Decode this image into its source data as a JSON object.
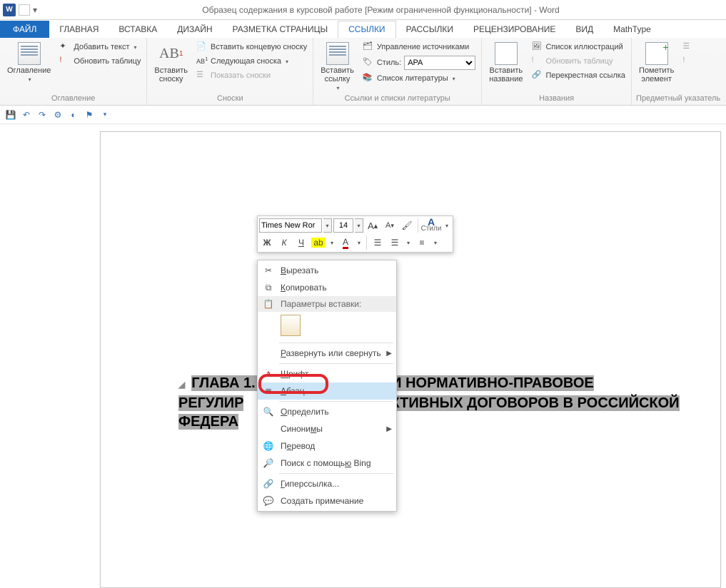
{
  "titlebar": {
    "title": "Образец содержания в курсовой работе [Режим ограниченной функциональности] - Word"
  },
  "tabs": {
    "file": "ФАЙЛ",
    "home": "ГЛАВНАЯ",
    "insert": "ВСТАВКА",
    "design": "ДИЗАЙН",
    "layout": "РАЗМЕТКА СТРАНИЦЫ",
    "references": "ССЫЛКИ",
    "mailings": "РАССЫЛКИ",
    "review": "РЕЦЕНЗИРОВАНИЕ",
    "view": "ВИД",
    "mathtype": "MathType"
  },
  "ribbon": {
    "toc_group": {
      "label": "Оглавление",
      "toc_btn": "Оглавление",
      "add_text": "Добавить текст",
      "update": "Обновить таблицу"
    },
    "footnotes_group": {
      "label": "Сноски",
      "insert_footnote": "Вставить\nсноску",
      "insert_endnote": "Вставить концевую сноску",
      "next_footnote": "Следующая сноска",
      "show_notes": "Показать сноски"
    },
    "citations_group": {
      "label": "Ссылки и списки литературы",
      "insert_citation": "Вставить\nссылку",
      "manage_sources": "Управление источниками",
      "style_label": "Стиль:",
      "style_value": "APA",
      "bibliography": "Список литературы"
    },
    "captions_group": {
      "label": "Названия",
      "insert_caption": "Вставить\nназвание",
      "table_of_figures": "Список иллюстраций",
      "update_table": "Обновить таблицу",
      "cross_reference": "Перекрестная ссылка"
    },
    "index_group": {
      "label": "Предметный указатель",
      "mark_entry": "Пометить\nэлемент"
    }
  },
  "mini_toolbar": {
    "font_name": "Times New Ror",
    "font_size": "14",
    "bold": "Ж",
    "italic": "К",
    "underline": "Ч",
    "styles_label": "Стили"
  },
  "document": {
    "heading_line1_a": "ГЛАВА 1. ",
    "heading_line1_b": "Ь И НОРМАТИВНО-ПРАВОВОЕ",
    "heading_line2_a": "РЕГУЛИР",
    "heading_line2_b": "КТИВНЫХ ДОГОВОРОВ В РОССИЙСКОЙ",
    "heading_line3_a": "ФЕДЕРА"
  },
  "context_menu": {
    "cut": "Вырезать",
    "copy": "Копировать",
    "paste_header": "Параметры вставки:",
    "expand_collapse": "Развернуть или свернуть",
    "font": "Шрифт...",
    "paragraph": "Абзац...",
    "define": "Определить",
    "synonyms": "Синонимы",
    "translate": "Перевод",
    "search_bing": "Поиск с помощью Bing",
    "hyperlink": "Гиперссылка...",
    "new_comment": "Создать примечание"
  }
}
